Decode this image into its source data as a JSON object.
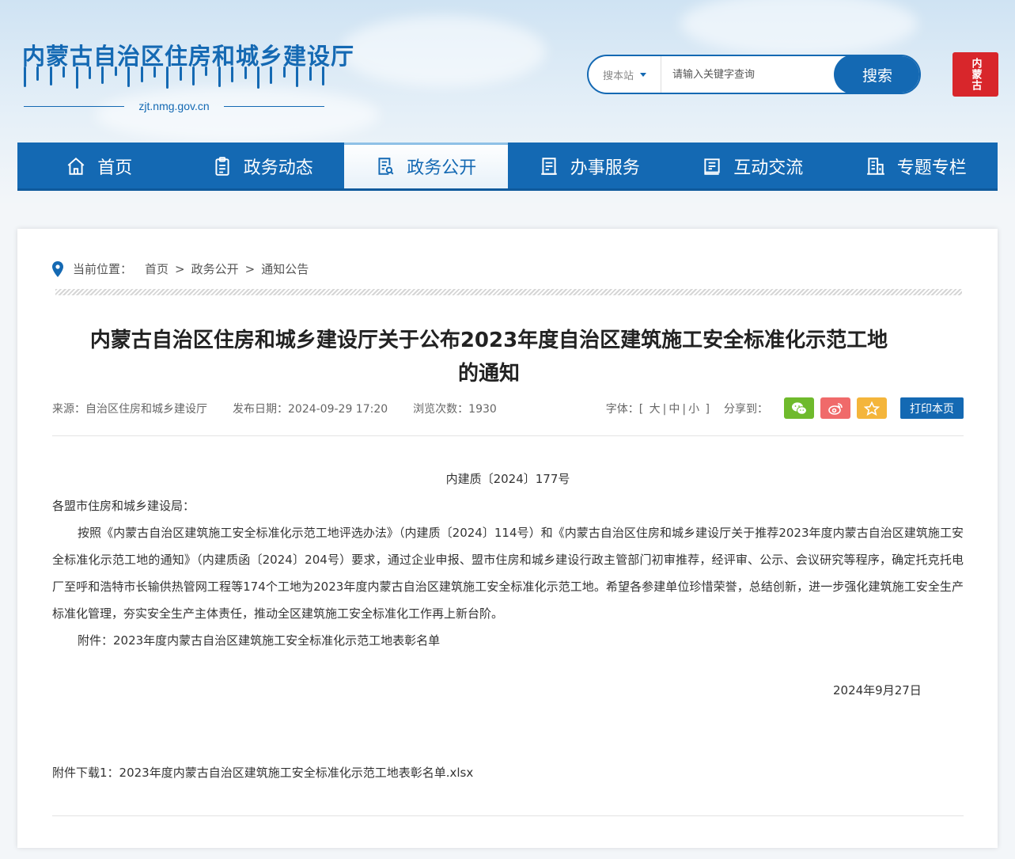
{
  "header": {
    "site_title": "内蒙古自治区住房和城乡建设厅",
    "domain": "zjt.nmg.gov.cn",
    "search": {
      "scope_label": "搜本站",
      "placeholder": "请输入关键字查询",
      "button_label": "搜索"
    },
    "seal_text": "内蒙古"
  },
  "nav": {
    "items": [
      {
        "label": "首页",
        "icon": "home-icon"
      },
      {
        "label": "政务动态",
        "icon": "clipboard-icon"
      },
      {
        "label": "政务公开",
        "icon": "document-search-icon",
        "active": true
      },
      {
        "label": "办事服务",
        "icon": "form-icon"
      },
      {
        "label": "互动交流",
        "icon": "book-icon"
      },
      {
        "label": "专题专栏",
        "icon": "building-icon"
      }
    ],
    "accent_color": "#1469b3"
  },
  "breadcrumb": {
    "prefix": "当前位置：",
    "items": [
      "首页",
      "政务公开",
      "通知公告"
    ],
    "separator": ">"
  },
  "article": {
    "title_line1": "内蒙古自治区住房和城乡建设厅关于公布2023年度自治区建筑施工安全标准化示范工地",
    "title_line2": "的通知",
    "meta": {
      "source": "来源：自治区住房和城乡建设厅",
      "date": "发布日期：2024-09-29 17:20",
      "views": "浏览次数：1930",
      "font_label": "字体：",
      "font_open": "[",
      "font_large": "大",
      "font_medium": "中",
      "font_small": "小",
      "font_close": "]",
      "font_sep": "|",
      "share_label": "分享到：",
      "share_colors": {
        "wechat": "#6fba2c",
        "weibo": "#f06a6a",
        "favorite": "#f4b53b"
      },
      "print_label": "打印本页"
    },
    "doc_number": "内建质〔2024〕177号",
    "salutation": "各盟市住房和城乡建设局：",
    "paragraph": "按照《内蒙古自治区建筑施工安全标准化示范工地评选办法》（内建质〔2024〕114号）和《内蒙古自治区住房和城乡建设厅关于推荐2023年度内蒙古自治区建筑施工安全标准化示范工地的通知》（内建质函〔2024〕204号）要求，通过企业申报、盟市住房和城乡建设行政主管部门初审推荐，经评审、公示、会议研究等程序，确定托克托电厂至呼和浩特市长输供热管网工程等174个工地为2023年度内蒙古自治区建筑施工安全标准化示范工地。希望各参建单位珍惜荣誉，总结创新，进一步强化建筑施工安全生产标准化管理，夯实安全生产主体责任，推动全区建筑施工安全标准化工作再上新台阶。",
    "attachment_note": "附件：2023年度内蒙古自治区建筑施工安全标准化示范工地表彰名单",
    "sign_date": "2024年9月27日",
    "download_prefix": "附件下载1：",
    "download_file": "2023年度内蒙古自治区建筑施工安全标准化示范工地表彰名单.xlsx"
  }
}
